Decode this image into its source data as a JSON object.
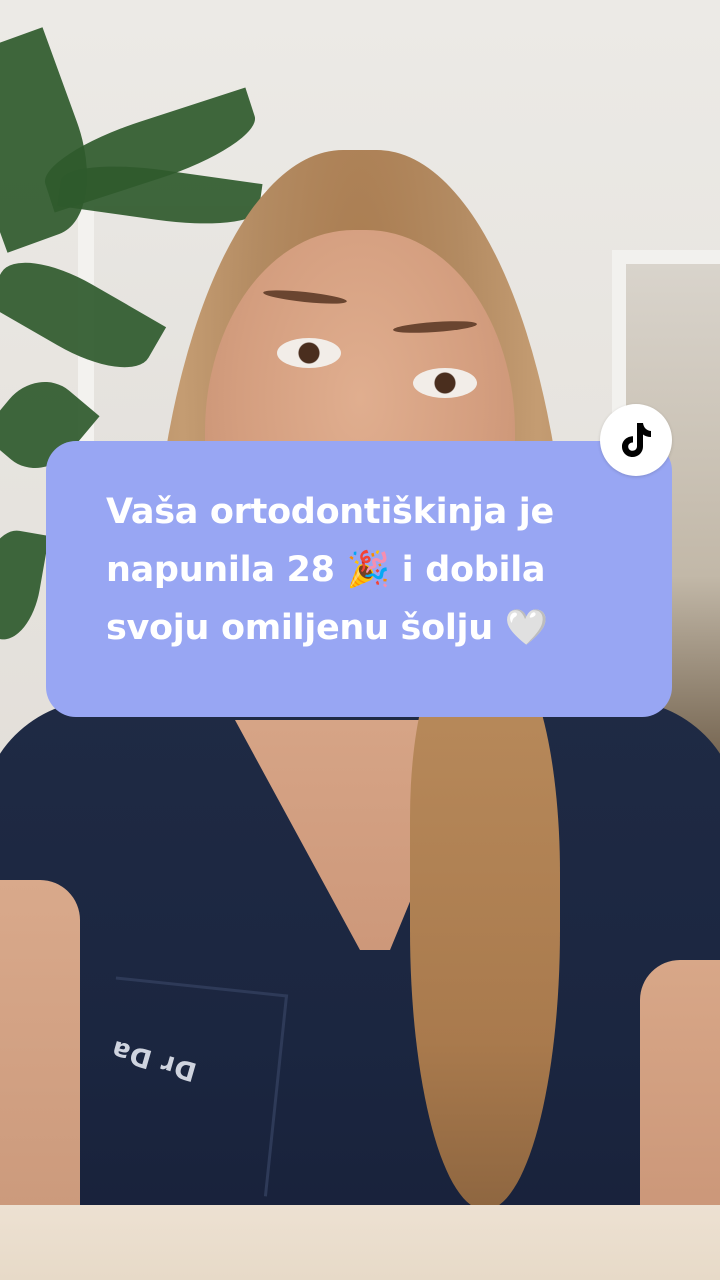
{
  "caption": {
    "lines": [
      "Vaša ortodontiškinja je",
      "napunila 28 🎉 i dobila",
      "svoju omiljenu šolju 🤍"
    ],
    "background_color": "#98a6f3",
    "text_color": "#ffffff"
  },
  "badge": {
    "icon": "tiktok-logo-icon",
    "background_color": "#ffffff"
  },
  "scene": {
    "embroidery_text": "Dr Da"
  }
}
